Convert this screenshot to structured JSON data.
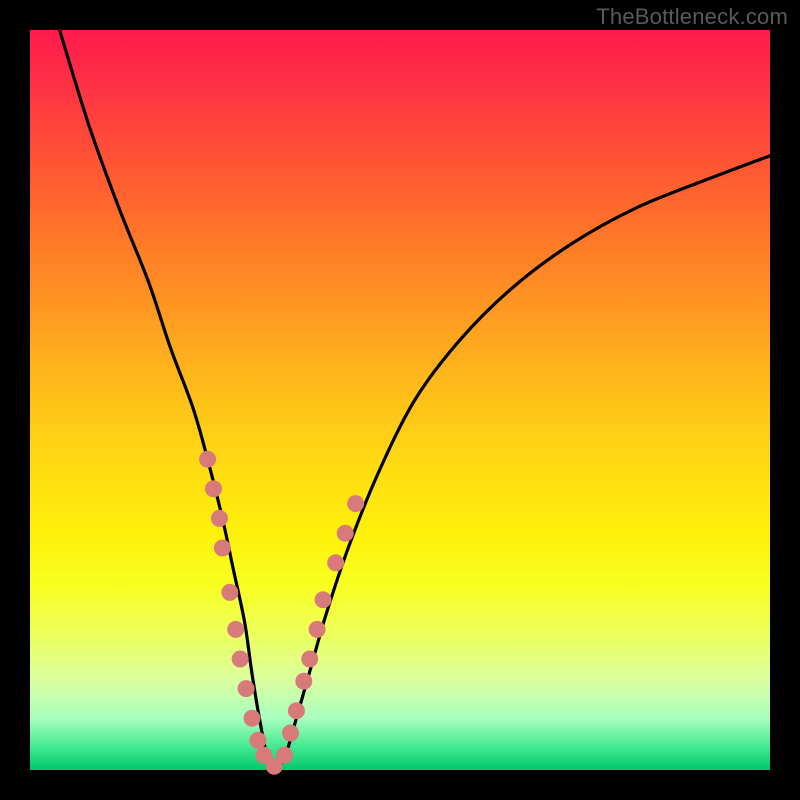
{
  "watermark": "TheBottleneck.com",
  "chart_data": {
    "type": "line",
    "title": "",
    "xlabel": "",
    "ylabel": "",
    "xlim": [
      0,
      100
    ],
    "ylim": [
      0,
      100
    ],
    "series": [
      {
        "name": "bottleneck-curve",
        "x": [
          4,
          8,
          12,
          16,
          19,
          22,
          24,
          26,
          27.5,
          29,
          30,
          31,
          32,
          33,
          34.5,
          36,
          38,
          40,
          43,
          47,
          52,
          58,
          65,
          73,
          82,
          92,
          100
        ],
        "values": [
          100,
          87,
          76,
          66,
          57,
          49,
          42,
          34,
          27,
          20,
          13,
          7,
          2,
          0,
          2,
          7,
          14,
          21,
          30,
          40,
          50,
          58,
          65,
          71,
          76,
          80,
          83
        ]
      }
    ],
    "markers": {
      "name": "highlighted-points",
      "color": "#d97a7a",
      "points_xy": [
        [
          24.0,
          42
        ],
        [
          24.8,
          38
        ],
        [
          25.6,
          34
        ],
        [
          26.0,
          30
        ],
        [
          27.0,
          24
        ],
        [
          27.8,
          19
        ],
        [
          28.4,
          15
        ],
        [
          29.2,
          11
        ],
        [
          30.0,
          7
        ],
        [
          30.8,
          4
        ],
        [
          31.6,
          2
        ],
        [
          33.0,
          0.5
        ],
        [
          34.4,
          2
        ],
        [
          35.2,
          5
        ],
        [
          36.0,
          8
        ],
        [
          37.0,
          12
        ],
        [
          37.8,
          15
        ],
        [
          38.8,
          19
        ],
        [
          39.6,
          23
        ],
        [
          41.3,
          28
        ],
        [
          42.6,
          32
        ],
        [
          44.0,
          36
        ]
      ]
    },
    "gradient_bands": [
      {
        "label": "red",
        "range_pct": [
          0,
          30
        ]
      },
      {
        "label": "orange",
        "range_pct": [
          30,
          55
        ]
      },
      {
        "label": "yellow",
        "range_pct": [
          55,
          85
        ]
      },
      {
        "label": "green",
        "range_pct": [
          85,
          100
        ]
      }
    ]
  }
}
